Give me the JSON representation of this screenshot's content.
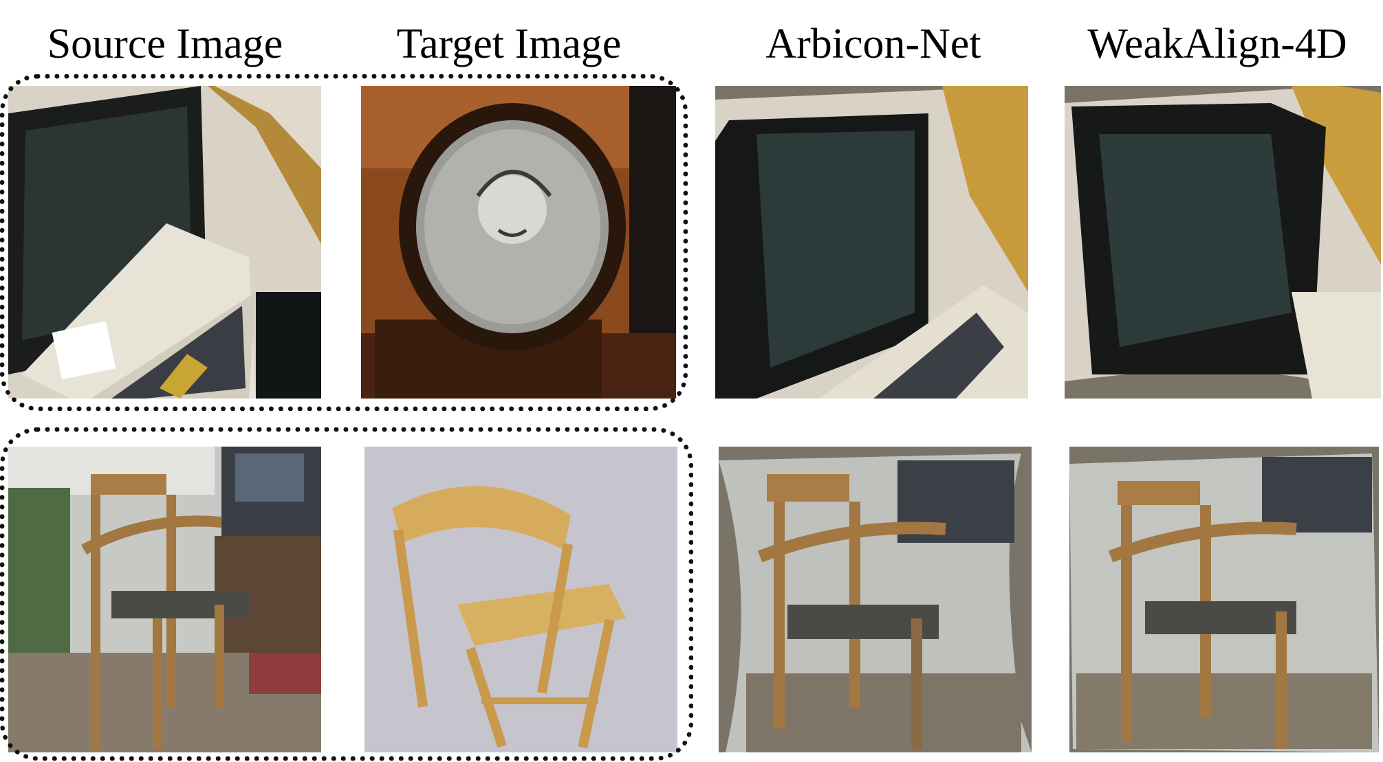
{
  "columns": [
    {
      "title": "Source Image"
    },
    {
      "title": "Target Image"
    },
    {
      "title": "Arbicon-Net"
    },
    {
      "title": "WeakAlign-4D"
    }
  ],
  "rows": [
    {
      "subject": "computer monitor and keyboard vs retro television"
    },
    {
      "subject": "wooden chair in living room vs folding chair"
    }
  ],
  "colors": {
    "warp_background": "#7a7468",
    "outline": "#111111"
  }
}
